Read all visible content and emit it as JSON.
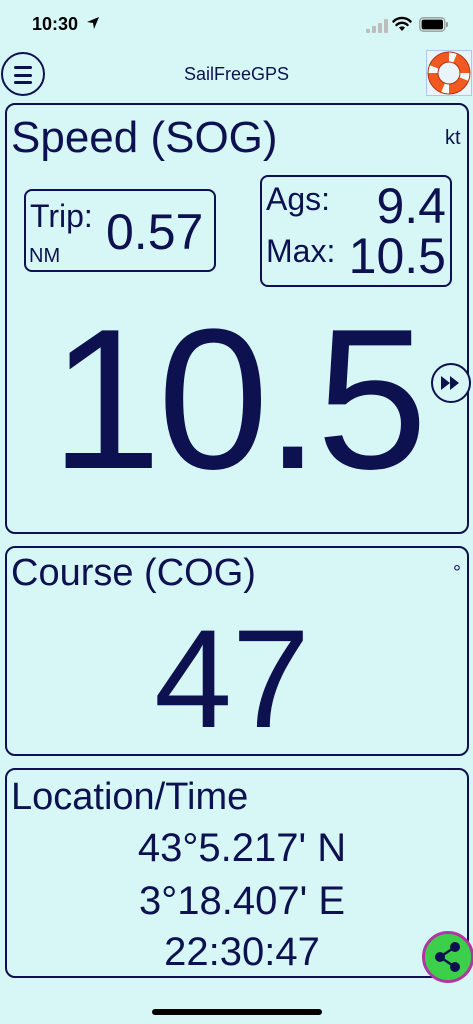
{
  "status": {
    "time": "10:30"
  },
  "nav": {
    "title": "SailFreeGPS"
  },
  "speed": {
    "title": "Speed (SOG)",
    "unit": "kt",
    "trip_label": "Trip:",
    "trip_unit": "NM",
    "trip_value": "0.57",
    "avg_label": "Ags:",
    "avg_value": "9.4",
    "max_label": "Max:",
    "max_value": "10.5",
    "value": "10.5"
  },
  "course": {
    "title": "Course (COG)",
    "unit": "°",
    "value": "47"
  },
  "location": {
    "title": "Location/Time",
    "latitude": "43°5.217' N",
    "longitude": "3°18.407' E",
    "time": "22:30:47"
  },
  "icons": {
    "menu": "hamburger-icon",
    "lifebuoy": "lifebuoy-icon",
    "fast_forward": "fast-forward-icon",
    "share": "share-icon"
  },
  "colors": {
    "background": "#d6f7f6",
    "text": "#0d1150",
    "share_bg": "#3cd04a",
    "share_ring": "#b136a3",
    "lifebuoy_orange": "#f05a22"
  }
}
